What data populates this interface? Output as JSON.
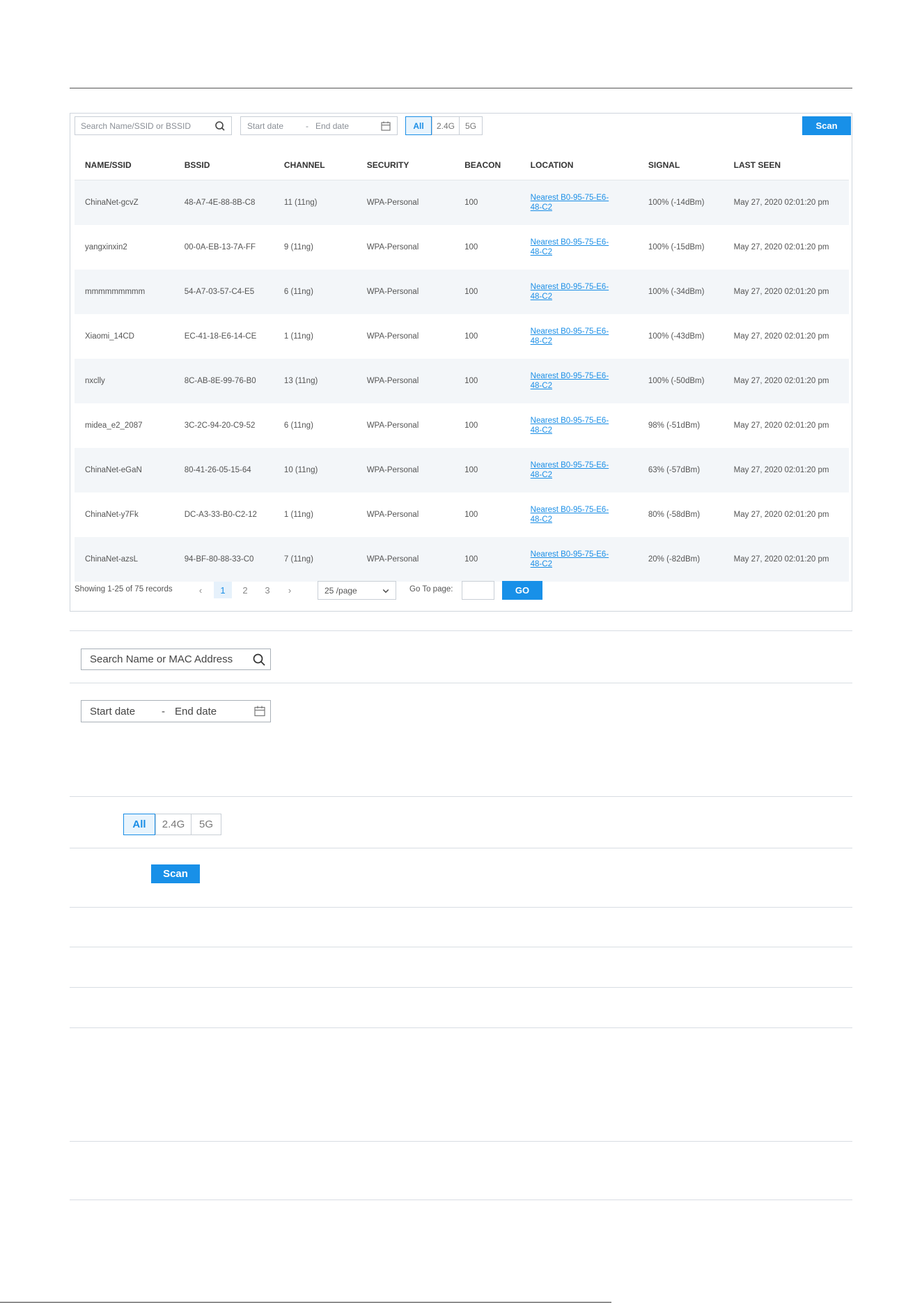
{
  "toolbar": {
    "search_placeholder": "Search Name/SSID or BSSID",
    "start_date": "Start date",
    "end_date": "End date",
    "date_sep": "-",
    "filters": [
      "All",
      "2.4G",
      "5G"
    ],
    "scan_label": "Scan"
  },
  "table": {
    "headers": [
      "NAME/SSID",
      "BSSID",
      "CHANNEL",
      "SECURITY",
      "BEACON",
      "LOCATION",
      "SIGNAL",
      "LAST SEEN"
    ],
    "rows": [
      [
        "ChinaNet-gcvZ",
        "48-A7-4E-88-8B-C8",
        "11 (11ng)",
        "WPA-Personal",
        "100",
        "Nearest B0-95-75-E6-48-C2",
        "100% (-14dBm)",
        "May 27, 2020 02:01:20 pm"
      ],
      [
        "yangxinxin2",
        "00-0A-EB-13-7A-FF",
        "9 (11ng)",
        "WPA-Personal",
        "100",
        "Nearest B0-95-75-E6-48-C2",
        "100% (-15dBm)",
        "May 27, 2020 02:01:20 pm"
      ],
      [
        "mmmmmmmmm",
        "54-A7-03-57-C4-E5",
        "6 (11ng)",
        "WPA-Personal",
        "100",
        "Nearest B0-95-75-E6-48-C2",
        "100% (-34dBm)",
        "May 27, 2020 02:01:20 pm"
      ],
      [
        "Xiaomi_14CD",
        "EC-41-18-E6-14-CE",
        "1 (11ng)",
        "WPA-Personal",
        "100",
        "Nearest B0-95-75-E6-48-C2",
        "100% (-43dBm)",
        "May 27, 2020 02:01:20 pm"
      ],
      [
        "nxclly",
        "8C-AB-8E-99-76-B0",
        "13 (11ng)",
        "WPA-Personal",
        "100",
        "Nearest B0-95-75-E6-48-C2",
        "100% (-50dBm)",
        "May 27, 2020 02:01:20 pm"
      ],
      [
        "midea_e2_2087",
        "3C-2C-94-20-C9-52",
        "6 (11ng)",
        "WPA-Personal",
        "100",
        "Nearest B0-95-75-E6-48-C2",
        "98% (-51dBm)",
        "May 27, 2020 02:01:20 pm"
      ],
      [
        "ChinaNet-eGaN",
        "80-41-26-05-15-64",
        "10 (11ng)",
        "WPA-Personal",
        "100",
        "Nearest B0-95-75-E6-48-C2",
        "63% (-57dBm)",
        "May 27, 2020 02:01:20 pm"
      ],
      [
        "ChinaNet-y7Fk",
        "DC-A3-33-B0-C2-12",
        "1 (11ng)",
        "WPA-Personal",
        "100",
        "Nearest B0-95-75-E6-48-C2",
        "80% (-58dBm)",
        "May 27, 2020 02:01:20 pm"
      ],
      [
        "ChinaNet-azsL",
        "94-BF-80-88-33-C0",
        "7 (11ng)",
        "WPA-Personal",
        "100",
        "Nearest B0-95-75-E6-48-C2",
        "20% (-82dBm)",
        "May 27, 2020 02:01:20 pm"
      ]
    ]
  },
  "pager": {
    "summary": "Showing 1-25 of 75 records",
    "pages": [
      "1",
      "2",
      "3"
    ],
    "page_size": "25 /page",
    "goto_label": "Go To page:",
    "goto_value": "",
    "go_label": "GO"
  },
  "standalone": {
    "search_placeholder": "Search Name or MAC Address",
    "start_date": "Start date",
    "end_date": "End date",
    "date_sep": "-",
    "filters": [
      "All",
      "2.4G",
      "5G"
    ],
    "scan_label": "Scan"
  },
  "colors": {
    "accent": "#1890e8",
    "row_alt": "#f3f6f9",
    "divider": "#d8dde3"
  }
}
